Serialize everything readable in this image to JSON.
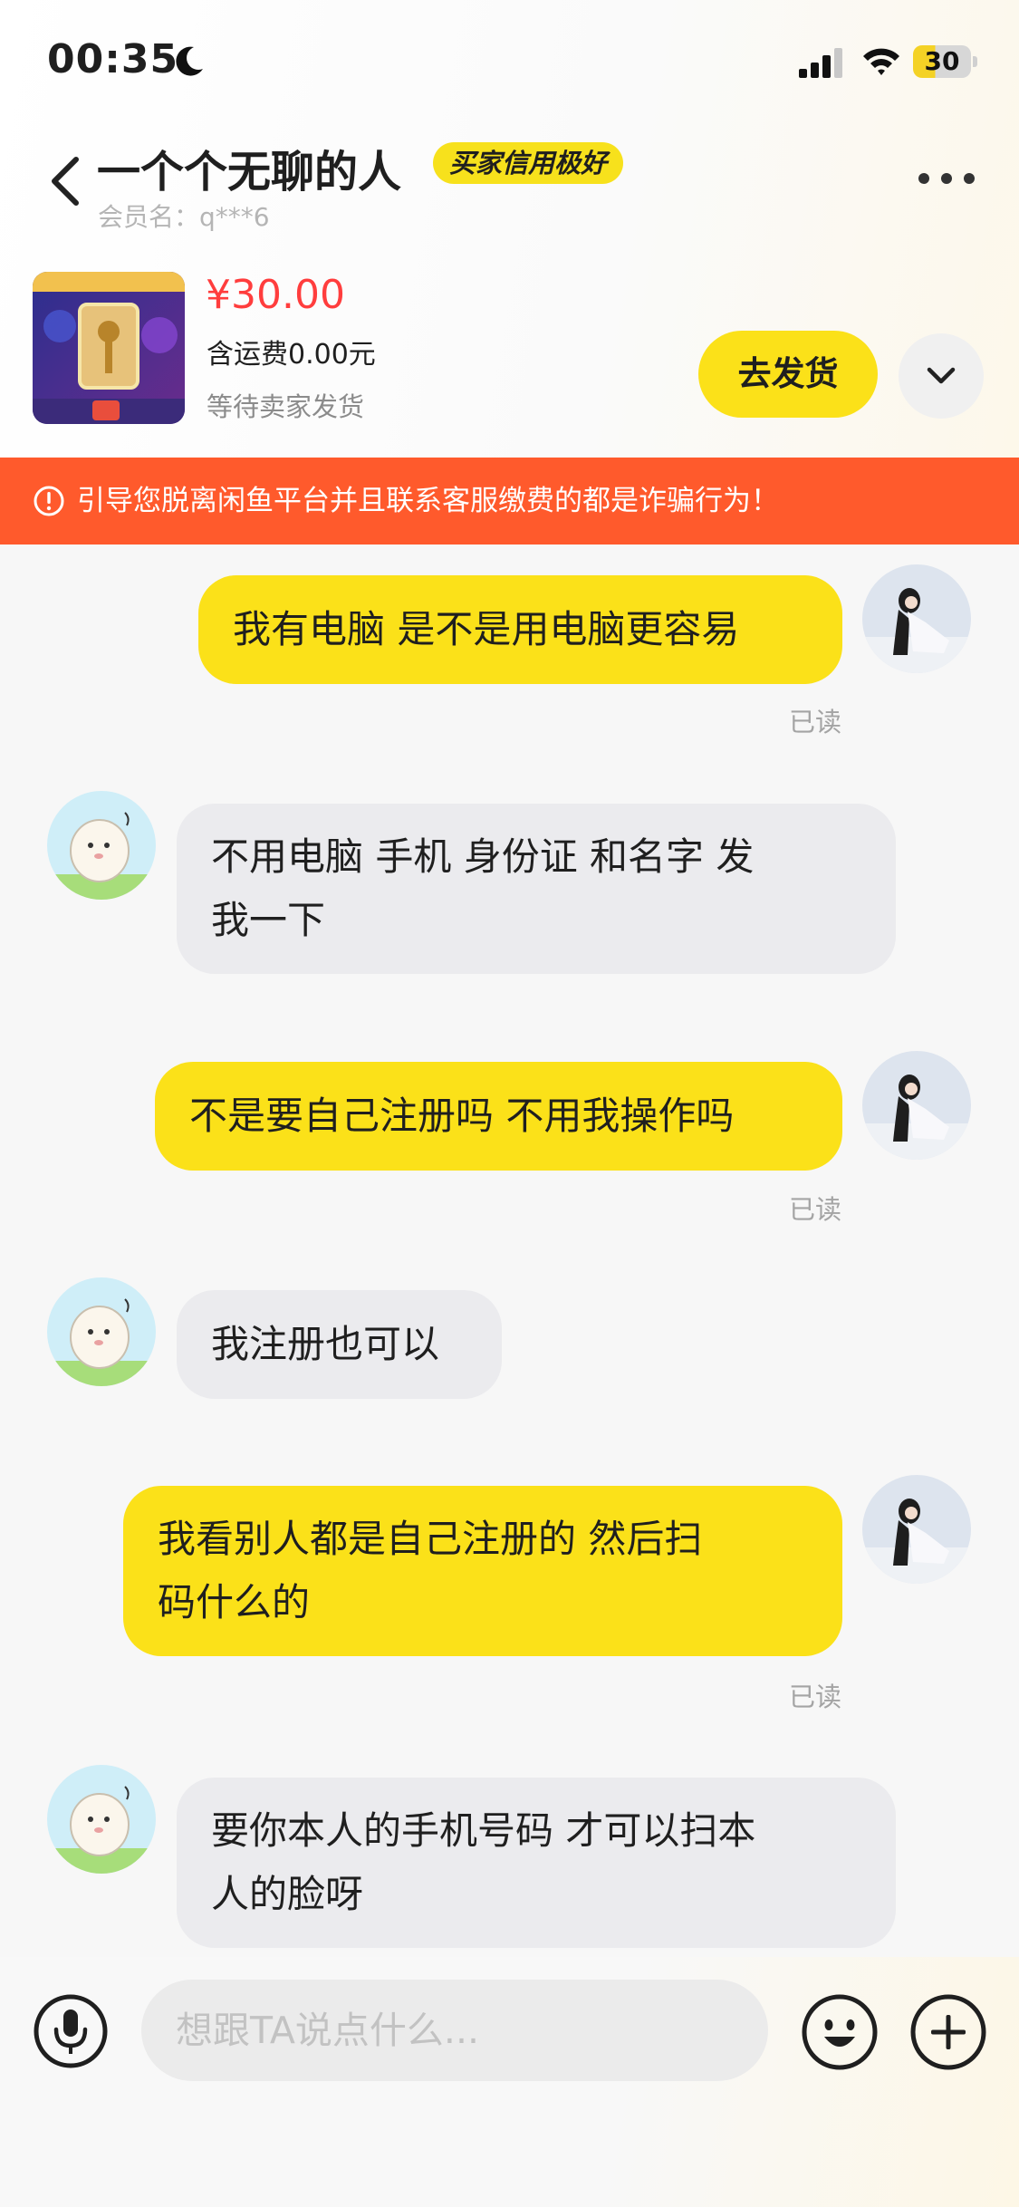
{
  "status_bar": {
    "time": "00:35",
    "battery": "30"
  },
  "header": {
    "title": "一个个无聊的人",
    "badge": "买家信用极好",
    "member": "会员名：q***6"
  },
  "product": {
    "price": "¥30.00",
    "shipping": "含运费0.00元",
    "status": "等待卖家发货",
    "ship_button": "去发货"
  },
  "warning": "引导您脱离闲鱼平台并且联系客服缴费的都是诈骗行为！",
  "messages": [
    {
      "side": "mine",
      "lines": [
        "我有电脑 是不是用电脑更容易"
      ],
      "read": "已读"
    },
    {
      "side": "theirs",
      "lines": [
        "不用电脑 手机 身份证 和名字 发",
        "我一下"
      ]
    },
    {
      "side": "mine",
      "lines": [
        "不是要自己注册吗 不用我操作吗"
      ],
      "read": "已读"
    },
    {
      "side": "theirs",
      "lines": [
        "我注册也可以"
      ]
    },
    {
      "side": "mine",
      "lines": [
        "我看别人都是自己注册的 然后扫",
        "码什么的"
      ],
      "read": "已读"
    },
    {
      "side": "theirs",
      "lines": [
        "要你本人的手机号码 才可以扫本",
        "人的脸呀"
      ]
    }
  ],
  "input": {
    "placeholder": "想跟TA说点什么..."
  },
  "colors": {
    "accent_yellow": "#fbe119",
    "price_red": "#ff3d3d",
    "warning_orange": "#ff5a2c"
  },
  "icons": [
    "moon-icon",
    "signal-icon",
    "wifi-icon",
    "back-icon",
    "more-icon",
    "chevron-down-icon",
    "warning-icon",
    "microphone-icon",
    "emoji-icon",
    "plus-icon"
  ]
}
